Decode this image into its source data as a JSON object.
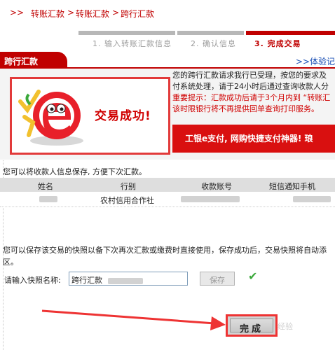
{
  "breadcrumb": {
    "sep1": ">",
    "sep2": ">",
    "item1": "转账汇款",
    "sep3": ">",
    "item2": "转账汇款",
    "sep4": ">",
    "item3": "跨行汇款"
  },
  "steps": [
    {
      "label": "1. 输入转账汇款信息"
    },
    {
      "label": "2. 确认信息"
    },
    {
      "label": "3. 完成交易"
    }
  ],
  "tab": {
    "label": "跨行汇款",
    "link": ">>体验记"
  },
  "result": {
    "success": "交易成功!",
    "notice_l1": "您的跨行汇款请求我行已受理，按您的要求及",
    "notice_l2": "付系统处理，请于24小时后通过查询收款人分",
    "notice_l3": "重要提示：汇款成功后请于3个月内到 “转账汇",
    "notice_l4": "该时限银行将不再提供回单查询打印服务。",
    "promo": "工银e支付, 网购快捷支付神器! 琅"
  },
  "payee_hint": "您可以将收款人信息保存, 方便下次汇款。",
  "table": {
    "headers": [
      "姓名",
      "行别",
      "收款账号",
      "短信通知手机"
    ],
    "row": {
      "bank": "农村信用合作社"
    }
  },
  "snapshot_hint_l1": "您可以保存该交易的快照以备下次再次汇款或缴费时直接使用，保存成功后，交易快照将自动添",
  "snapshot_hint_l2": "区。",
  "snapshot": {
    "label": "请输入快照名称:",
    "value": "跨行汇款",
    "save": "保存"
  },
  "done_label": "完成",
  "watermark": "经验",
  "colors": {
    "accent": "#c00000",
    "promo": "#d91010",
    "check": "#3aa83a"
  }
}
